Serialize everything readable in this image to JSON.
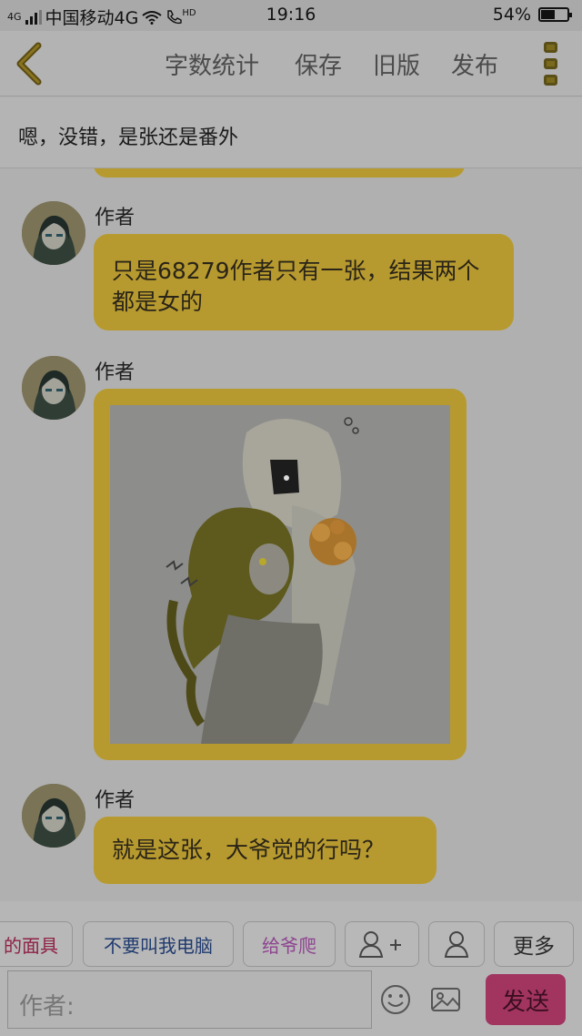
{
  "status_bar": {
    "carrier": "中国移动4G",
    "network_tag": "4G",
    "hd_tag": "HD",
    "time": "19:16",
    "battery": "54%",
    "battery_level": 0.54
  },
  "nav": {
    "word_count": "字数统计",
    "save": "保存",
    "old_version": "旧版",
    "publish": "发布"
  },
  "reply_quote": "嗯，没错，是张还是番外",
  "messages": [
    {
      "author": "作者",
      "text": "只是68279作者只有一张，结果两个都是女的"
    },
    {
      "author": "作者",
      "type": "image"
    },
    {
      "author": "作者",
      "text": "就是这张，大爷觉的行吗？"
    }
  ],
  "quick_phrases": {
    "items": [
      "的面具",
      "不要叫我电脑",
      "给爷爬",
      "更多"
    ],
    "colors": [
      "#8e2244",
      "#1f3a6e",
      "#8e4490",
      "#2a2a2a"
    ]
  },
  "input": {
    "placeholder": "作者:",
    "send": "发送"
  },
  "colors": {
    "bubble": "#b79a2f",
    "send_button": "#a23560"
  }
}
